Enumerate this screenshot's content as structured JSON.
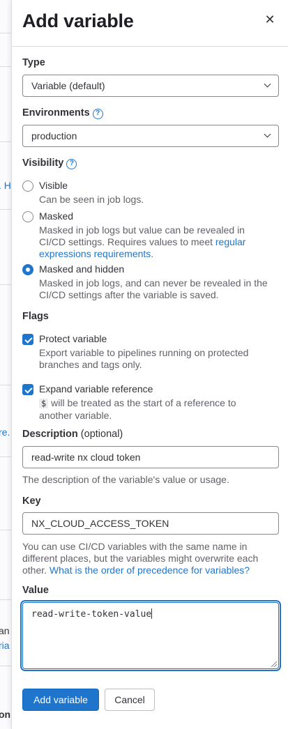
{
  "background_page": {
    "fragments": [
      {
        "text": ". H",
        "style": "link"
      },
      {
        "text": "re.",
        "style": "link"
      },
      {
        "text": "an",
        "style": "dark"
      },
      {
        "text": "ria",
        "style": "link"
      },
      {
        "text": "onn",
        "style": "strong"
      }
    ]
  },
  "drawer": {
    "title": "Add variable",
    "close_icon": "close-icon",
    "type": {
      "label": "Type",
      "selected": "Variable (default)"
    },
    "environments": {
      "label": "Environments",
      "help_icon": "question-circle-icon",
      "selected": "production"
    },
    "visibility": {
      "label": "Visibility",
      "help_icon": "question-circle-icon",
      "options": [
        {
          "title": "Visible",
          "help": "Can be seen in job logs.",
          "checked": false
        },
        {
          "title": "Masked",
          "help": "Masked in job logs but value can be revealed in CI/CD settings. Requires values to meet ",
          "help_link": "regular expressions requirements",
          "help_after": ".",
          "checked": false
        },
        {
          "title": "Masked and hidden",
          "help": "Masked in job logs, and can never be revealed in the CI/CD settings after the variable is saved.",
          "checked": true
        }
      ]
    },
    "flags": {
      "label": "Flags",
      "protect": {
        "title": "Protect variable",
        "help": "Export variable to pipelines running on protected branches and tags only.",
        "checked": true
      },
      "expand": {
        "title": "Expand variable reference",
        "code": "$",
        "help": " will be treated as the start of a reference to another variable.",
        "checked": true
      }
    },
    "description": {
      "label": "Description",
      "optional": "(optional)",
      "value": "read-write nx cloud token",
      "help": "The description of the variable's value or usage."
    },
    "key": {
      "label": "Key",
      "value": "NX_CLOUD_ACCESS_TOKEN",
      "help": "You can use CI/CD variables with the same name in different places, but the variables might overwrite each other. ",
      "help_link": "What is the order of precedence for variables?"
    },
    "value": {
      "label": "Value",
      "value": "read-write-token-value"
    },
    "buttons": {
      "submit": "Add variable",
      "cancel": "Cancel"
    }
  },
  "colors": {
    "accent": "#1f75cb",
    "text": "#333238",
    "muted": "#626168",
    "border": "#89888d"
  }
}
